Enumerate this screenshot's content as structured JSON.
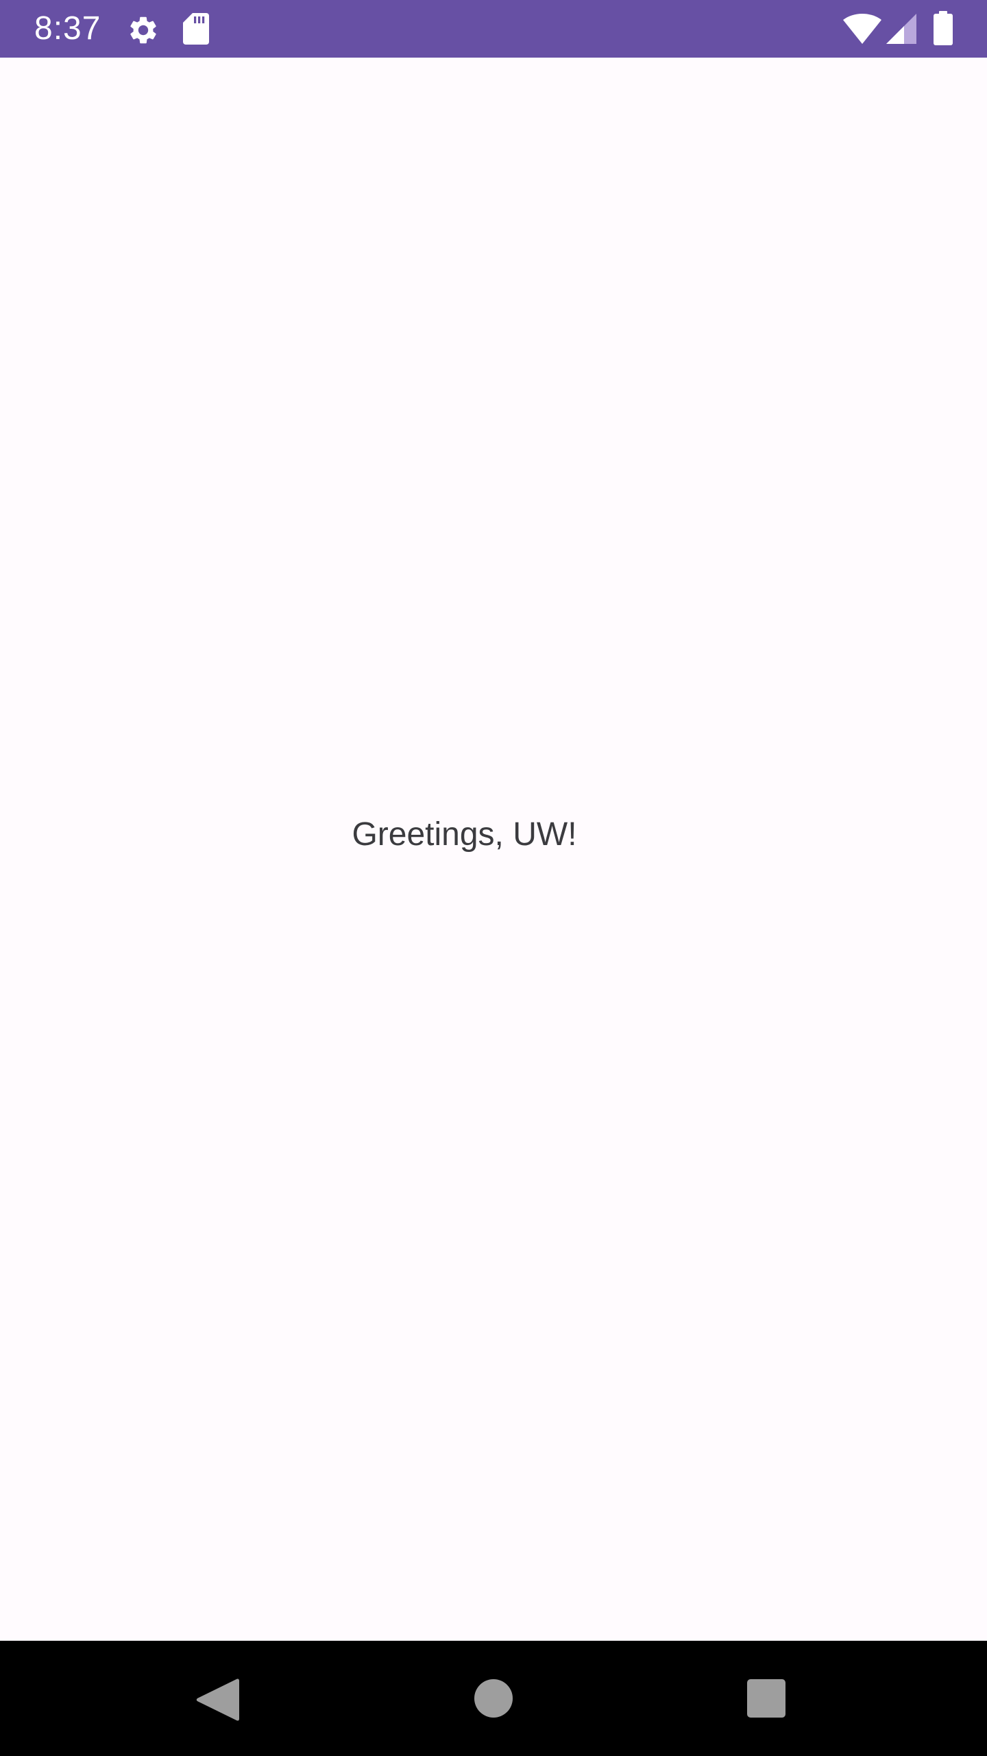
{
  "status_bar": {
    "time": "8:37",
    "background_color": "#6750a4",
    "icons": [
      "gear-icon",
      "sdcard-icon",
      "wifi-icon",
      "signal-icon",
      "battery-icon"
    ]
  },
  "main": {
    "greeting": "Greetings, UW!",
    "background_color": "#fffbfe"
  },
  "nav_bar": {
    "buttons": [
      "back-icon",
      "home-icon",
      "recents-icon"
    ],
    "background_color": "#000000"
  }
}
